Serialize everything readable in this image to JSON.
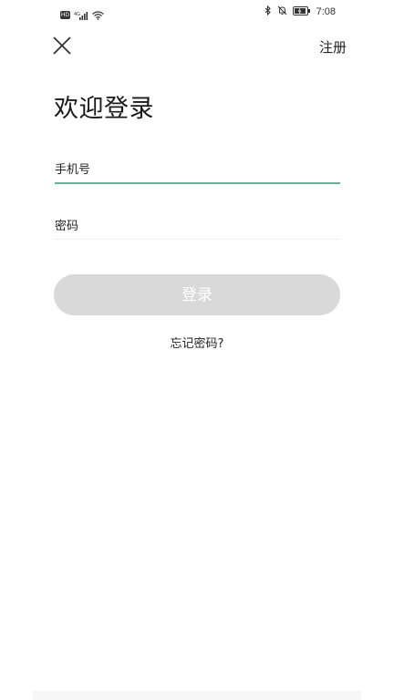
{
  "status_bar": {
    "hd_label": "HD",
    "signal_label": "⁴ᴳ",
    "time": "7:08"
  },
  "header": {
    "register_label": "注册"
  },
  "title": "欢迎登录",
  "form": {
    "phone_placeholder": "手机号",
    "password_placeholder": "密码"
  },
  "login_button_label": "登录",
  "forgot_password_label": "忘记密码?",
  "colors": {
    "accent": "#5fb593",
    "button_disabled": "#d9d9d9"
  }
}
